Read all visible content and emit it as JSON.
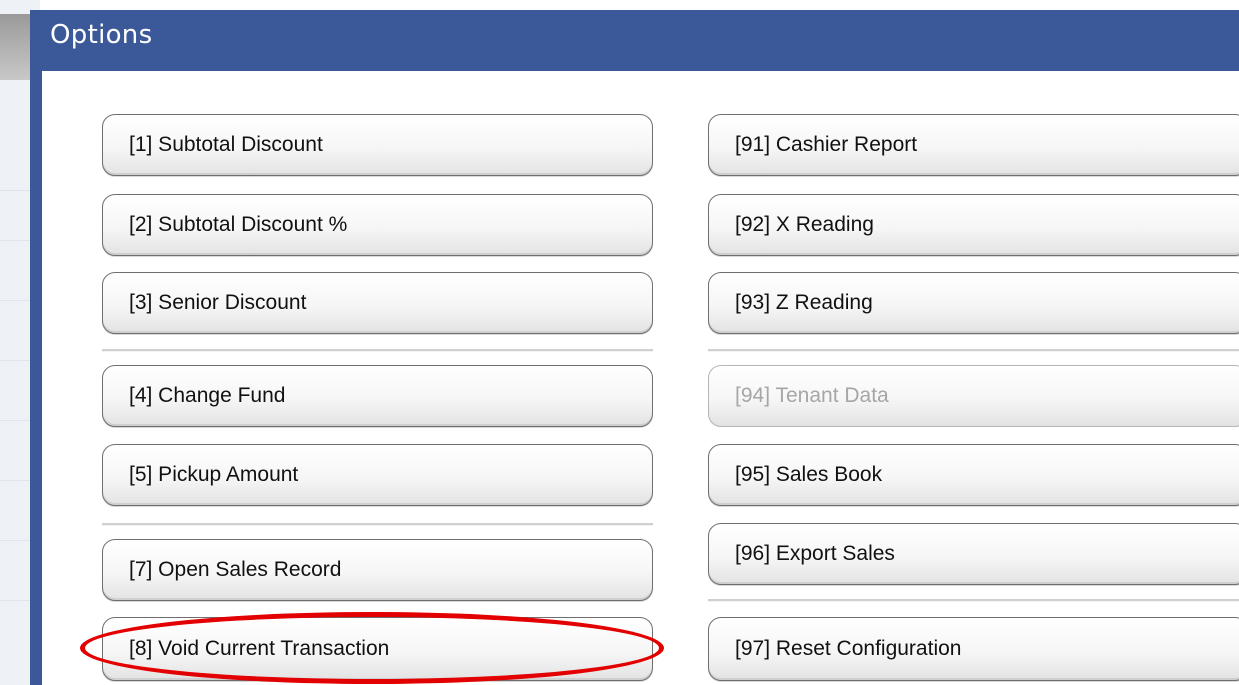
{
  "dialog": {
    "title": "Options"
  },
  "left_column": [
    {
      "label": "[1]  Subtotal Discount",
      "enabled": true
    },
    {
      "label": "[2]  Subtotal Discount %",
      "enabled": true
    },
    {
      "label": "[3]  Senior Discount",
      "enabled": true
    },
    {
      "label": "[4]  Change Fund",
      "enabled": true
    },
    {
      "label": "[5]  Pickup Amount",
      "enabled": true
    },
    {
      "label": "[7]  Open Sales Record",
      "enabled": true
    },
    {
      "label": "[8]  Void Current Transaction",
      "enabled": true,
      "highlighted": true
    }
  ],
  "right_column": [
    {
      "label": "[91]  Cashier Report",
      "enabled": true
    },
    {
      "label": "[92]  X Reading",
      "enabled": true
    },
    {
      "label": "[93]  Z Reading",
      "enabled": true
    },
    {
      "label": "[94]  Tenant Data",
      "enabled": false
    },
    {
      "label": "[95]  Sales Book",
      "enabled": true
    },
    {
      "label": "[96]  Export Sales",
      "enabled": true
    },
    {
      "label": "[97]  Reset Configuration",
      "enabled": true
    }
  ],
  "colors": {
    "titlebar": "#3b5998",
    "highlight": "#e30000",
    "disabled_text": "#a6a6a6"
  }
}
